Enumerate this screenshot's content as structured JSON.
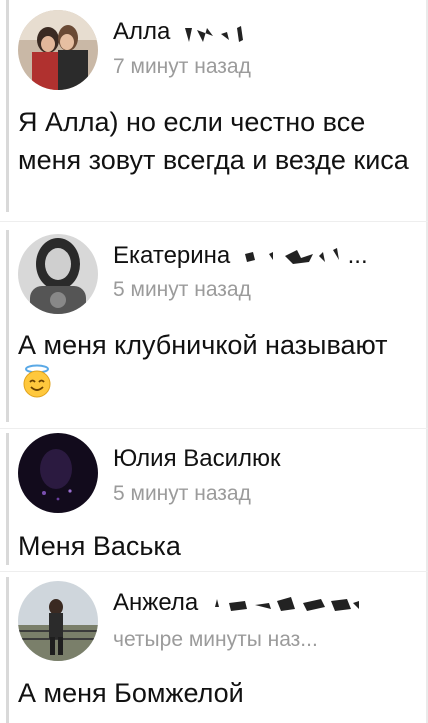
{
  "comments": [
    {
      "author": "Алла",
      "time": "7 минут назад",
      "text": "Я Алла) но если честно все меня зовут всегда и везде киса"
    },
    {
      "author": "Екатерина",
      "ellipsis": "...",
      "time": "5 минут назад",
      "text": "А меня клубничкой называют"
    },
    {
      "author": "Юлия Василюк",
      "time": "5 минут назад",
      "text": "Меня Васька"
    },
    {
      "author": "Анжела",
      "time": "четыре минуты наз...",
      "text": "А меня Бомжелой"
    }
  ],
  "colors": {
    "author": "#111111",
    "time": "#9b9b9b",
    "thread_bar": "#d9d9d9"
  },
  "icons": [
    "smiling-face-with-halo-icon"
  ]
}
